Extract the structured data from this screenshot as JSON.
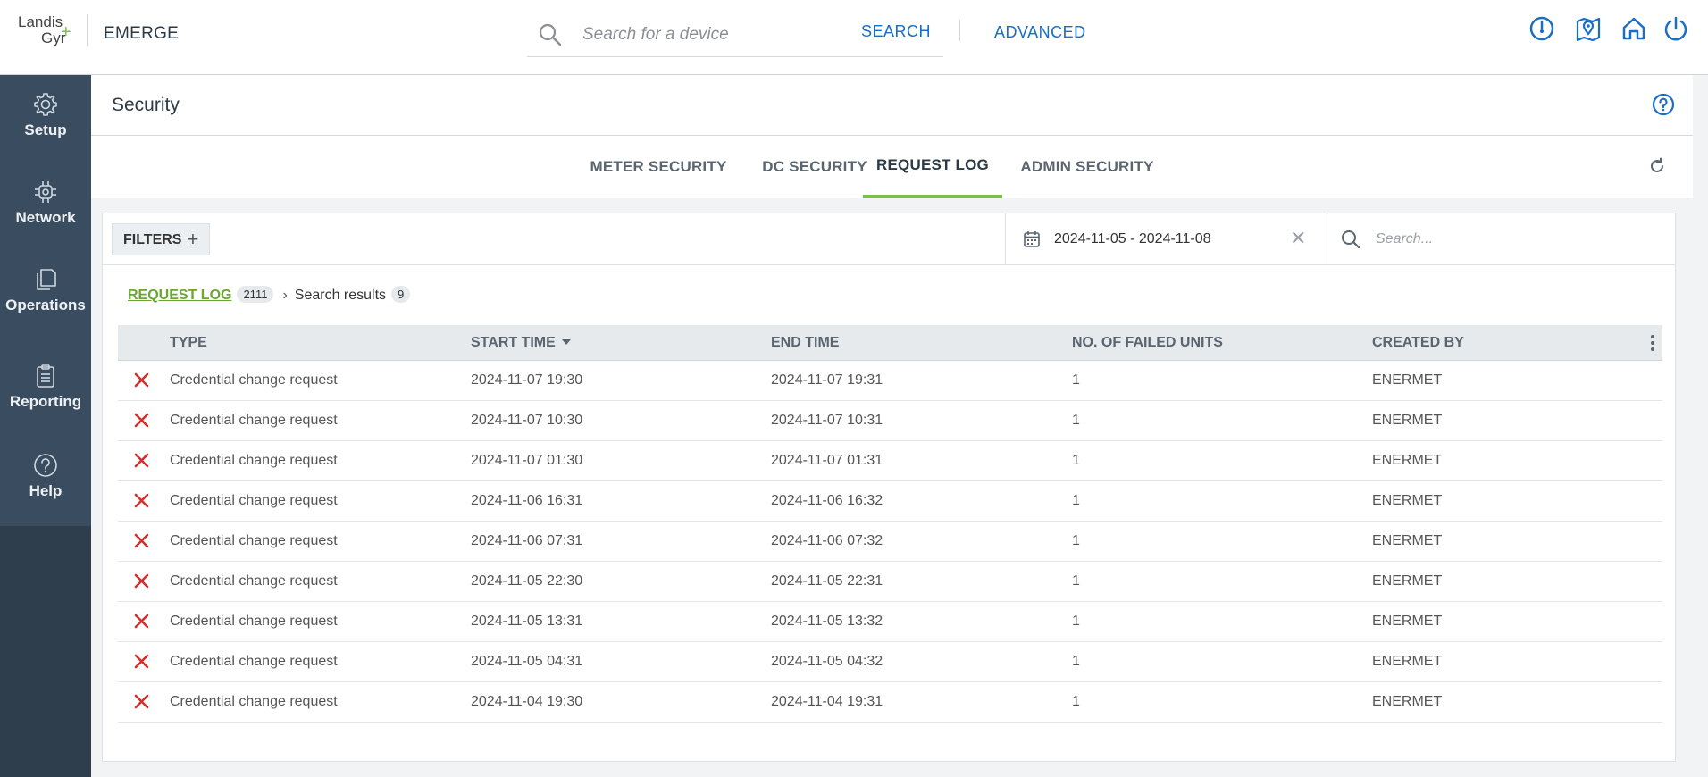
{
  "header": {
    "logo_line1": "Landis",
    "logo_line2": "Gyr",
    "logo_plus": "+",
    "app_name": "EMERGE",
    "search_placeholder": "Search for a device",
    "search_label": "SEARCH",
    "advanced_label": "ADVANCED",
    "icons": [
      "dashboard-icon",
      "map-pin-icon",
      "home-icon",
      "power-icon"
    ]
  },
  "sidebar": {
    "items": [
      {
        "label": "Setup",
        "icon": "gear-icon"
      },
      {
        "label": "Network",
        "icon": "chip-icon"
      },
      {
        "label": "Operations",
        "icon": "documents-icon"
      },
      {
        "label": "Reporting",
        "icon": "clipboard-icon"
      },
      {
        "label": "Help",
        "icon": "help-icon"
      }
    ]
  },
  "page": {
    "title": "Security"
  },
  "tabs": [
    {
      "label": "METER SECURITY",
      "active": false
    },
    {
      "label": "DC SECURITY",
      "active": false
    },
    {
      "label": "REQUEST LOG",
      "active": true
    },
    {
      "label": "ADMIN SECURITY",
      "active": false
    }
  ],
  "filters": {
    "label": "FILTERS",
    "date_range": "2024-11-05 - 2024-11-08",
    "search_placeholder": "Search..."
  },
  "breadcrumb": {
    "root_label": "REQUEST LOG",
    "root_count": "2111",
    "current_label": "Search results",
    "current_count": "9"
  },
  "table": {
    "columns": [
      "TYPE",
      "START TIME",
      "END TIME",
      "NO. OF FAILED UNITS",
      "CREATED BY"
    ],
    "rows": [
      {
        "type": "Credential change request",
        "start": "2024-11-07 19:30",
        "end": "2024-11-07 19:31",
        "failed": "1",
        "created_by": "ENERMET"
      },
      {
        "type": "Credential change request",
        "start": "2024-11-07 10:30",
        "end": "2024-11-07 10:31",
        "failed": "1",
        "created_by": "ENERMET"
      },
      {
        "type": "Credential change request",
        "start": "2024-11-07 01:30",
        "end": "2024-11-07 01:31",
        "failed": "1",
        "created_by": "ENERMET"
      },
      {
        "type": "Credential change request",
        "start": "2024-11-06 16:31",
        "end": "2024-11-06 16:32",
        "failed": "1",
        "created_by": "ENERMET"
      },
      {
        "type": "Credential change request",
        "start": "2024-11-06 07:31",
        "end": "2024-11-06 07:32",
        "failed": "1",
        "created_by": "ENERMET"
      },
      {
        "type": "Credential change request",
        "start": "2024-11-05 22:30",
        "end": "2024-11-05 22:31",
        "failed": "1",
        "created_by": "ENERMET"
      },
      {
        "type": "Credential change request",
        "start": "2024-11-05 13:31",
        "end": "2024-11-05 13:32",
        "failed": "1",
        "created_by": "ENERMET"
      },
      {
        "type": "Credential change request",
        "start": "2024-11-05 04:31",
        "end": "2024-11-05 04:32",
        "failed": "1",
        "created_by": "ENERMET"
      },
      {
        "type": "Credential change request",
        "start": "2024-11-04 19:30",
        "end": "2024-11-04 19:31",
        "failed": "1",
        "created_by": "ENERMET"
      }
    ]
  },
  "colors": {
    "accent_green": "#7ac143",
    "link_blue": "#1a6fc4",
    "sidebar_bg": "#3a4d60",
    "error_red": "#d32f2f"
  }
}
